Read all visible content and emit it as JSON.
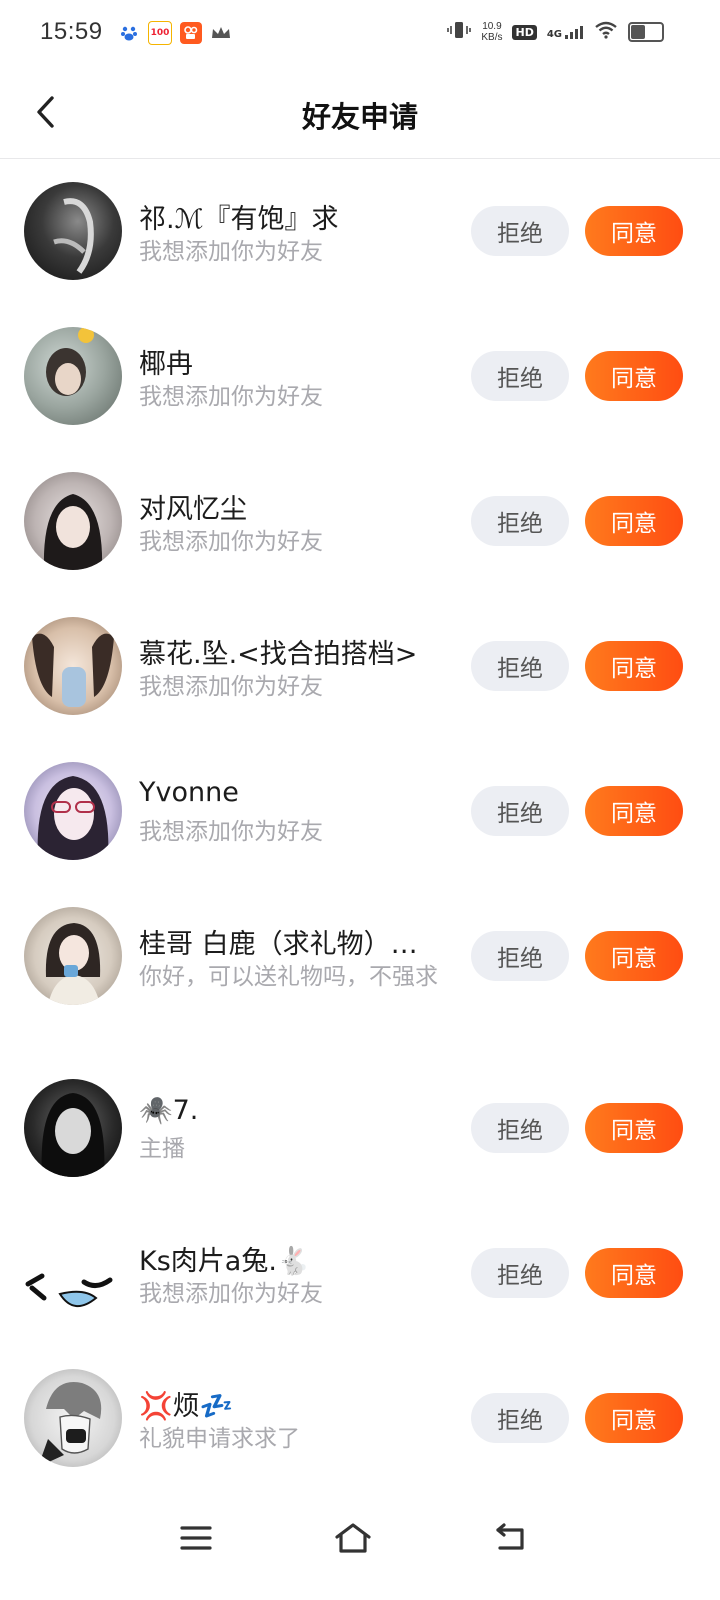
{
  "status_bar": {
    "time": "15:59",
    "net_speed_value": "10.9",
    "net_speed_unit": "KB/s",
    "hd_label": "HD",
    "network_label": "4G",
    "app_icons": [
      "baidu-icon",
      "100-app-icon",
      "kuaishou-app-icon",
      "crown-icon"
    ],
    "app_100_label": "100"
  },
  "header": {
    "title": "好友申请",
    "back_icon": "chevron-left-icon"
  },
  "buttons": {
    "reject_label": "拒绝",
    "accept_label": "同意"
  },
  "requests": [
    {
      "name": "祁.ℳ『有饱』求",
      "message": "我想添加你为好友"
    },
    {
      "name": "椰冉",
      "message": "我想添加你为好友"
    },
    {
      "name": "对风忆尘",
      "message": "我想添加你为好友"
    },
    {
      "name": "慕花.坠.<找合拍搭档>",
      "message": "我想添加你为好友"
    },
    {
      "name": "Yvonne",
      "message": "我想添加你为好友"
    },
    {
      "name": "桂哥 白鹿（求礼物）…",
      "message": "你好，可以送礼物吗，不强求"
    },
    {
      "name": "🕷️7.",
      "message": "主播"
    },
    {
      "name": "Ks肉片a兔.🐇",
      "message": "我想添加你为好友"
    },
    {
      "name": "💢烦💤",
      "message": "礼貌申请求求了"
    }
  ],
  "colors": {
    "accent_start": "#ff7a1d",
    "accent_end": "#ff4d12",
    "reject_bg": "#eceef3",
    "secondary_text": "#a9a9ae"
  },
  "nav": {
    "icons": [
      "menu-icon",
      "home-icon",
      "back-icon"
    ]
  }
}
